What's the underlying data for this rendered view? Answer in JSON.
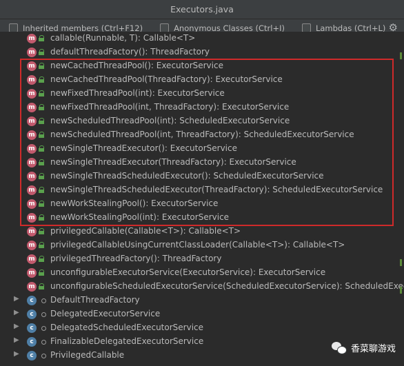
{
  "window": {
    "title": "Executors.java"
  },
  "toolbar": {
    "inherited": "Inherited members (Ctrl+F12)",
    "anonymous": "Anonymous Classes (Ctrl+I)",
    "lambdas": "Lambdas (Ctrl+L)",
    "settings_icon": "gear-icon"
  },
  "methods": [
    "callable(Runnable, T): Callable<T>",
    "defaultThreadFactory(): ThreadFactory",
    "newCachedThreadPool(): ExecutorService",
    "newCachedThreadPool(ThreadFactory): ExecutorService",
    "newFixedThreadPool(int): ExecutorService",
    "newFixedThreadPool(int, ThreadFactory): ExecutorService",
    "newScheduledThreadPool(int): ScheduledExecutorService",
    "newScheduledThreadPool(int, ThreadFactory): ScheduledExecutorService",
    "newSingleThreadExecutor(): ExecutorService",
    "newSingleThreadExecutor(ThreadFactory): ExecutorService",
    "newSingleThreadScheduledExecutor(): ScheduledExecutorService",
    "newSingleThreadScheduledExecutor(ThreadFactory): ScheduledExecutorService",
    "newWorkStealingPool(): ExecutorService",
    "newWorkStealingPool(int): ExecutorService",
    "privilegedCallable(Callable<T>): Callable<T>",
    "privilegedCallableUsingCurrentClassLoader(Callable<T>): Callable<T>",
    "privilegedThreadFactory(): ThreadFactory",
    "unconfigurableExecutorService(ExecutorService): ExecutorService",
    "unconfigurableScheduledExecutorService(ScheduledExecutorService): ScheduledExecutorService"
  ],
  "classes": [
    "DefaultThreadFactory",
    "DelegatedExecutorService",
    "DelegatedScheduledExecutorService",
    "FinalizableDelegatedExecutorService",
    "PrivilegedCallable"
  ],
  "badges": {
    "method": "m",
    "class": "c"
  },
  "watermark": {
    "text": "香菜聊游戏"
  },
  "colors": {
    "highlight_box": "#d02a2a",
    "method_badge": "#c25a6d",
    "class_badge": "#4f7fa6",
    "lock": "#5aa14d"
  }
}
